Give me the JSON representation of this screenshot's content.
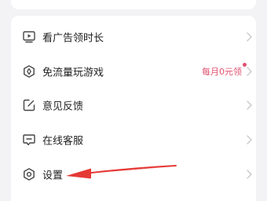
{
  "menu": {
    "items": [
      {
        "label": "看广告领时长",
        "icon": "play-screen-icon"
      },
      {
        "label": "免流量玩游戏",
        "icon": "free-data-icon",
        "promo_text": "每月0元领"
      },
      {
        "label": "意见反馈",
        "icon": "feedback-edit-icon"
      },
      {
        "label": "在线客服",
        "icon": "chat-message-icon"
      },
      {
        "label": "设置",
        "icon": "settings-gear-icon"
      }
    ]
  },
  "annotation": {
    "arrow": "red-arrow-pointing-left",
    "color": "#e53935"
  },
  "colors": {
    "accent": "#e0506f",
    "background": "#f3f3f5",
    "card": "#ffffff"
  }
}
